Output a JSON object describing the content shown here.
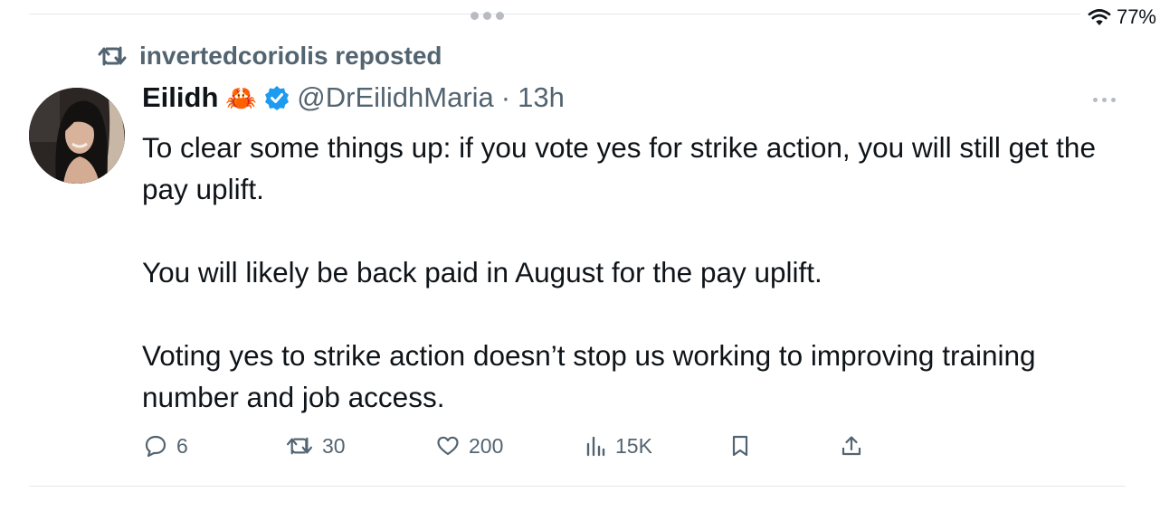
{
  "status_bar": {
    "battery": "77%",
    "wifi_icon": "wifi-icon"
  },
  "repost": {
    "label": "invertedcoriolis reposted",
    "icon": "repost-icon"
  },
  "tweet": {
    "author_name": "Eilidh",
    "author_emoji": "🦀",
    "verified_icon": "verified-badge-icon",
    "handle": "@DrEilidhMaria",
    "separator": "·",
    "time": "13h",
    "paragraphs": [
      "To clear some things up: if you vote yes for strike action, you will still get the pay uplift.",
      "You will likely be back paid in August for the pay uplift.",
      "Voting yes to strike action doesn’t stop us working to improving training number and job access."
    ]
  },
  "actions": {
    "replies": "6",
    "reposts": "30",
    "likes": "200",
    "views": "15K"
  },
  "colors": {
    "muted": "#536471",
    "text": "#0f1419",
    "verified": "#1d9bf0"
  }
}
